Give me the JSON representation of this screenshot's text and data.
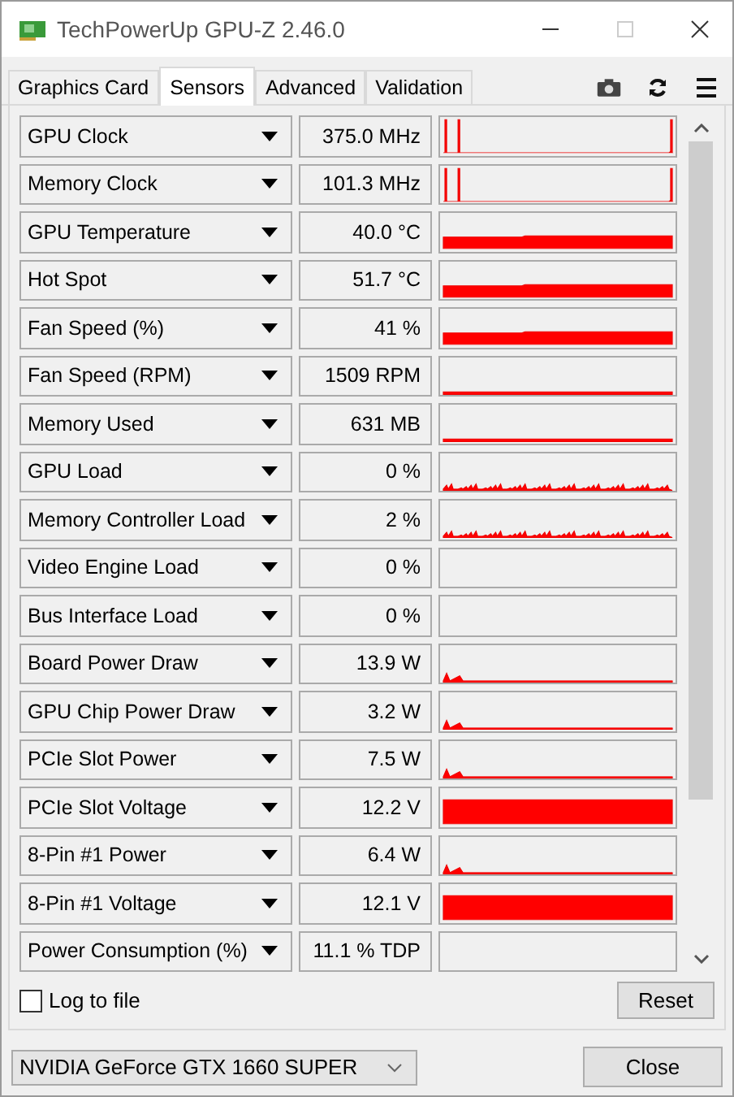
{
  "window": {
    "title": "TechPowerUp GPU-Z 2.46.0"
  },
  "tabs": [
    {
      "label": "Graphics Card",
      "selected": false
    },
    {
      "label": "Sensors",
      "selected": true
    },
    {
      "label": "Advanced",
      "selected": false
    },
    {
      "label": "Validation",
      "selected": false
    }
  ],
  "sensors": [
    {
      "name": "GPU Clock",
      "value": "375.0 MHz",
      "kind": "spikes"
    },
    {
      "name": "Memory Clock",
      "value": "101.3 MHz",
      "kind": "spikes"
    },
    {
      "name": "GPU Temperature",
      "value": "40.0 °C",
      "kind": "band"
    },
    {
      "name": "Hot Spot",
      "value": "51.7 °C",
      "kind": "band"
    },
    {
      "name": "Fan Speed (%)",
      "value": "41 %",
      "kind": "band"
    },
    {
      "name": "Fan Speed (RPM)",
      "value": "1509 RPM",
      "kind": "line"
    },
    {
      "name": "Memory Used",
      "value": "631 MB",
      "kind": "line"
    },
    {
      "name": "GPU Load",
      "value": "0 %",
      "kind": "noise"
    },
    {
      "name": "Memory Controller Load",
      "value": "2 %",
      "kind": "noise"
    },
    {
      "name": "Video Engine Load",
      "value": "0 %",
      "kind": "empty"
    },
    {
      "name": "Bus Interface Load",
      "value": "0 %",
      "kind": "empty"
    },
    {
      "name": "Board Power Draw",
      "value": "13.9 W",
      "kind": "blip"
    },
    {
      "name": "GPU Chip Power Draw",
      "value": "3.2 W",
      "kind": "blip"
    },
    {
      "name": "PCIe Slot Power",
      "value": "7.5 W",
      "kind": "blip"
    },
    {
      "name": "PCIe Slot Voltage",
      "value": "12.2 V",
      "kind": "full"
    },
    {
      "name": "8-Pin #1 Power",
      "value": "6.4 W",
      "kind": "blip"
    },
    {
      "name": "8-Pin #1 Voltage",
      "value": "12.1 V",
      "kind": "full"
    },
    {
      "name": "Power Consumption (%)",
      "value": "11.1 % TDP",
      "kind": "empty"
    }
  ],
  "log_to_file": {
    "label": "Log to file",
    "checked": false
  },
  "reset_button": "Reset",
  "device": "NVIDIA GeForce GTX 1660 SUPER",
  "close_button": "Close"
}
